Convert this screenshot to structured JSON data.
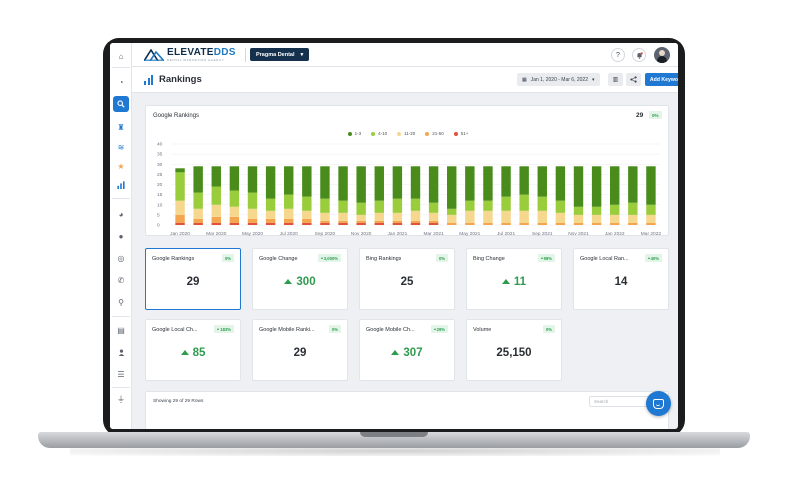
{
  "brand": {
    "name_part1": "ELEVATE",
    "name_part2": "DDS",
    "tagline": "DENTAL MARKETING AGENCY"
  },
  "topbar": {
    "practice": "Pragma Dental",
    "help_icon": "question-icon",
    "notifications_icon": "bell-icon"
  },
  "sidebar": {
    "items": [
      {
        "name": "home-icon"
      },
      {
        "name": "dashboard-icon"
      },
      {
        "name": "search-icon",
        "active": true
      },
      {
        "name": "trophy-icon"
      },
      {
        "name": "wifi-icon"
      },
      {
        "name": "star-icon"
      },
      {
        "name": "rankings-icon"
      },
      {
        "name": "pie-chart-icon"
      },
      {
        "name": "chat-icon"
      },
      {
        "name": "support-icon"
      },
      {
        "name": "phone-icon"
      },
      {
        "name": "location-pin-icon"
      },
      {
        "name": "document-icon"
      },
      {
        "name": "user-icon"
      },
      {
        "name": "list-icon"
      },
      {
        "name": "plug-icon"
      }
    ]
  },
  "page": {
    "title": "Rankings",
    "date_range": "Jan 1, 2020 - Mar 6, 2022",
    "add_keywords": "Add Keywords"
  },
  "chart_card": {
    "title": "Google Rankings",
    "total": "29",
    "badge": "0%"
  },
  "chart_data": {
    "type": "bar",
    "stacked": true,
    "title": "Google Rankings",
    "ylim": [
      0,
      40
    ],
    "yticks": [
      0,
      5,
      10,
      15,
      20,
      25,
      30,
      35,
      40
    ],
    "grid": true,
    "legend": "top-center",
    "x_tick_labels": [
      "Jan 2020",
      "Mar 2020",
      "May 2020",
      "Jul 2020",
      "Sep 2020",
      "Nov 2020",
      "Jan 2021",
      "Mar 2021",
      "May 2021",
      "Jul 2021",
      "Sep 2021",
      "Nov 2021",
      "Jan 2022",
      "Mar 2022"
    ],
    "categories": [
      "Jan 2020",
      "Feb 2020",
      "Mar 2020",
      "Apr 2020",
      "May 2020",
      "Jun 2020",
      "Jul 2020",
      "Aug 2020",
      "Sep 2020",
      "Oct 2020",
      "Nov 2020",
      "Dec 2020",
      "Jan 2021",
      "Feb 2021",
      "Mar 2021",
      "Apr 2021",
      "May 2021",
      "Jun 2021",
      "Jul 2021",
      "Aug 2021",
      "Sep 2021",
      "Oct 2021",
      "Nov 2021",
      "Dec 2021",
      "Jan 2022",
      "Feb 2022",
      "Mar 2022"
    ],
    "series": [
      {
        "name": "1-3",
        "color": "#4a8c1c",
        "values": [
          2,
          13,
          10,
          12,
          13,
          16,
          14,
          15,
          16,
          17,
          18,
          17,
          16,
          16,
          18,
          21,
          17,
          17,
          15,
          14,
          15,
          17,
          20,
          20,
          19,
          18,
          19
        ]
      },
      {
        "name": "4-10",
        "color": "#9acd3c",
        "values": [
          14,
          8,
          9,
          8,
          8,
          6,
          7,
          7,
          7,
          6,
          6,
          6,
          7,
          6,
          5,
          3,
          5,
          5,
          7,
          8,
          7,
          6,
          4,
          4,
          5,
          6,
          5
        ]
      },
      {
        "name": "11-20",
        "color": "#f5d78e",
        "values": [
          7,
          5,
          6,
          5,
          5,
          4,
          5,
          4,
          4,
          4,
          3,
          4,
          4,
          5,
          4,
          4,
          6,
          6,
          6,
          6,
          6,
          5,
          4,
          4,
          4,
          4,
          4
        ]
      },
      {
        "name": "21-50",
        "color": "#f3a64f",
        "values": [
          4,
          2,
          3,
          3,
          2,
          2,
          2,
          2,
          1,
          1,
          1,
          1,
          1,
          1,
          1,
          1,
          1,
          1,
          1,
          1,
          1,
          1,
          1,
          1,
          1,
          1,
          1
        ]
      },
      {
        "name": "51+",
        "color": "#e0523d",
        "values": [
          1,
          1,
          1,
          1,
          1,
          1,
          1,
          1,
          1,
          1,
          1,
          1,
          1,
          1,
          1,
          0,
          0,
          0,
          0,
          0,
          0,
          0,
          0,
          0,
          0,
          0,
          0
        ]
      }
    ]
  },
  "kpis": [
    {
      "label": "Google Rankings",
      "value": "29",
      "badge": "0%",
      "up": false,
      "badge_up": false,
      "selected": true
    },
    {
      "label": "Google Change",
      "value": "300",
      "badge": "3,000%",
      "up": true,
      "badge_up": true,
      "selected": false
    },
    {
      "label": "Bing Rankings",
      "value": "25",
      "badge": "0%",
      "up": false,
      "badge_up": false,
      "selected": false
    },
    {
      "label": "Bing Change",
      "value": "11",
      "badge": "98%",
      "up": true,
      "badge_up": true,
      "selected": false
    },
    {
      "label": "Google Local Ran...",
      "value": "14",
      "badge": "40%",
      "up": false,
      "badge_up": true,
      "selected": false
    },
    {
      "label": "Google Local Ch...",
      "value": "85",
      "badge": "183%",
      "up": true,
      "badge_up": true,
      "selected": false
    },
    {
      "label": "Google Mobile Ranki...",
      "value": "29",
      "badge": "0%",
      "up": false,
      "badge_up": false,
      "selected": false
    },
    {
      "label": "Google Mobile Ch...",
      "value": "307",
      "badge": "29%",
      "up": true,
      "badge_up": true,
      "selected": false
    },
    {
      "label": "Volume",
      "value": "25,150",
      "badge": "0%",
      "up": false,
      "badge_up": false,
      "selected": false
    }
  ],
  "table": {
    "rows_info": "Showing 29 of 29 Rows",
    "search_placeholder": "Search"
  },
  "colors": {
    "primary": "#1f78d1",
    "navy": "#14304d",
    "positive": "#2e9b4e"
  }
}
